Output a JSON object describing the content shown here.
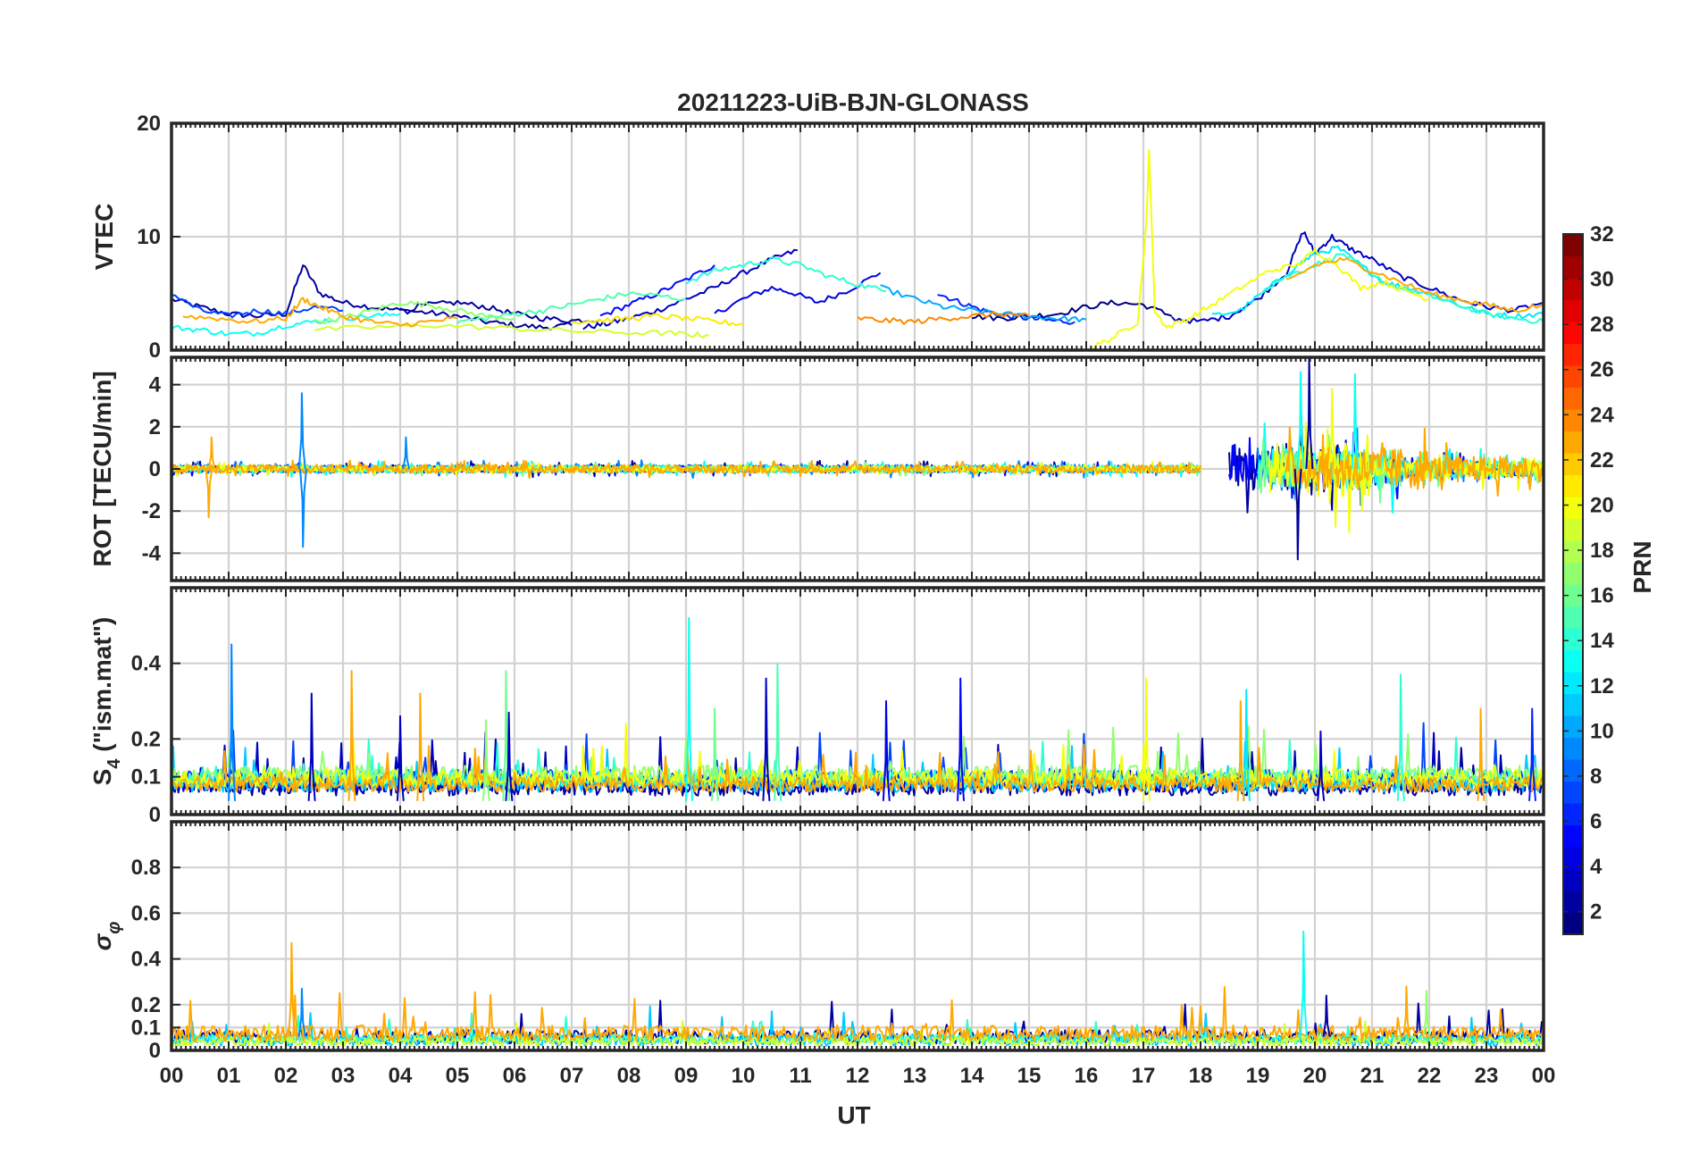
{
  "figure": {
    "title": "20211223-UiB-BJN-GLONASS",
    "xlabel": "UT",
    "x_tick_labels": [
      "00",
      "01",
      "02",
      "03",
      "04",
      "05",
      "06",
      "07",
      "08",
      "09",
      "10",
      "11",
      "12",
      "13",
      "14",
      "15",
      "16",
      "17",
      "18",
      "19",
      "20",
      "21",
      "22",
      "23",
      "00"
    ],
    "colorbar": {
      "label": "PRN",
      "range": [
        1,
        32
      ],
      "ticks": [
        2,
        4,
        6,
        8,
        10,
        12,
        14,
        16,
        18,
        20,
        22,
        24,
        26,
        28,
        30,
        32
      ],
      "colormap": "jet"
    }
  },
  "chart_data": [
    {
      "type": "line",
      "ylabel": "VTEC",
      "ylim": [
        0,
        20
      ],
      "yticks": [
        0,
        10,
        20
      ],
      "x_range_hours": [
        0,
        24
      ],
      "grid": true,
      "series": [
        {
          "prn": 2,
          "t": [
            0,
            0.5,
            1,
            1.5,
            2.0,
            2.3,
            2.6,
            3.0,
            3.5,
            4.0,
            4.5,
            5.0,
            5.5,
            6.0,
            6.5,
            7.0
          ],
          "v": [
            4.5,
            3.8,
            3.2,
            3.0,
            3.2,
            7.5,
            5.0,
            4.2,
            3.8,
            3.5,
            3.3,
            3.0,
            2.5,
            2.2,
            2.0,
            2.2
          ]
        },
        {
          "prn": 4,
          "t": [
            9.5,
            10.0,
            10.5,
            10.9,
            11.3,
            11.8,
            12.4
          ],
          "v": [
            3.2,
            4.5,
            5.5,
            5.0,
            4.2,
            5.2,
            6.8
          ]
        },
        {
          "prn": 3,
          "t": [
            7.2,
            7.6,
            8.0,
            8.5,
            9.0,
            9.5,
            10.0,
            10.5,
            10.95
          ],
          "v": [
            2.0,
            2.3,
            2.8,
            3.5,
            4.5,
            5.5,
            6.8,
            8.0,
            8.8
          ]
        },
        {
          "prn": 5,
          "t": [
            7.5,
            8.0,
            8.5,
            9.0,
            9.5
          ],
          "v": [
            3.0,
            4.0,
            5.0,
            6.2,
            7.5
          ]
        },
        {
          "prn": 6,
          "t": [
            13.4,
            13.8,
            14.2,
            14.6,
            15.0,
            15.4,
            15.8
          ],
          "v": [
            5.0,
            4.2,
            3.5,
            3.0,
            2.8,
            2.6,
            2.5
          ]
        },
        {
          "prn": 2,
          "t": [
            4.0,
            4.5,
            5.0,
            5.5,
            6.0,
            6.5,
            7.0,
            7.5
          ],
          "v": [
            3.5,
            4.0,
            4.2,
            3.8,
            3.2,
            2.8,
            2.6,
            2.7
          ]
        },
        {
          "prn": 1,
          "t": [
            14.0,
            14.5,
            15.0,
            15.5,
            16.0,
            16.5,
            17.0,
            17.5
          ],
          "v": [
            3.0,
            2.8,
            3.0,
            3.2,
            3.8,
            4.2,
            4.0,
            3.0
          ]
        },
        {
          "prn": 7,
          "t": [
            0,
            0.5,
            1.0,
            1.5,
            2.0,
            2.5,
            3.0
          ],
          "v": [
            5.0,
            3.5,
            3.0,
            3.5,
            3.2,
            3.8,
            3.5
          ]
        },
        {
          "prn": 3,
          "t": [
            17.5,
            18.0,
            18.5,
            19.0,
            19.5,
            19.8,
            20.0,
            20.3,
            20.6,
            21.0,
            21.5,
            22.0,
            22.5,
            23.0,
            23.5,
            24.0
          ],
          "v": [
            2.8,
            2.5,
            3.0,
            4.5,
            6.8,
            10.5,
            8.5,
            10.0,
            9.0,
            8.0,
            6.5,
            5.5,
            4.5,
            3.8,
            3.5,
            4.2
          ]
        },
        {
          "prn": 10,
          "t": [
            12.4,
            13.0,
            13.5,
            14.0,
            14.5,
            15.0,
            15.5,
            16.0
          ],
          "v": [
            5.5,
            4.5,
            3.8,
            3.5,
            3.2,
            3.0,
            2.8,
            2.7
          ]
        },
        {
          "prn": 12,
          "t": [
            18.2,
            18.7,
            19.2,
            19.7,
            20.0,
            20.4,
            20.8,
            21.2,
            21.6,
            22.0,
            22.5,
            23.0,
            23.5,
            24.0
          ],
          "v": [
            3.0,
            3.5,
            5.5,
            7.5,
            8.5,
            9.0,
            7.5,
            6.0,
            5.5,
            5.0,
            4.0,
            3.2,
            3.0,
            3.2
          ]
        },
        {
          "prn": 13,
          "t": [
            0,
            0.5,
            1.0,
            1.5,
            2.0,
            2.5,
            3.0,
            3.5,
            4.0
          ],
          "v": [
            2.0,
            1.8,
            1.4,
            1.5,
            2.2,
            2.5,
            2.8,
            3.0,
            3.2
          ]
        },
        {
          "prn": 14,
          "t": [
            9.0,
            9.5,
            10.0,
            10.5,
            11.0,
            11.5,
            12.0,
            12.5
          ],
          "v": [
            6.0,
            7.0,
            7.5,
            8.0,
            7.5,
            6.5,
            5.8,
            5.2
          ]
        },
        {
          "prn": 14,
          "t": [
            19.0,
            19.5,
            20.0,
            20.5,
            21.0,
            21.5,
            22.0,
            22.5,
            23.0,
            23.5,
            24.0
          ],
          "v": [
            5.0,
            6.5,
            7.5,
            8.5,
            6.5,
            5.5,
            4.8,
            4.0,
            3.2,
            2.8,
            2.5
          ]
        },
        {
          "prn": 15,
          "t": [
            5.0,
            5.5,
            6.0,
            6.5,
            7.0,
            7.5,
            8.0,
            8.5,
            9.0
          ],
          "v": [
            2.5,
            2.8,
            3.2,
            3.5,
            4.0,
            4.5,
            5.0,
            4.8,
            4.5
          ]
        },
        {
          "prn": 17,
          "t": [
            2.5,
            3.0,
            3.5,
            4.0,
            4.5,
            5.0,
            5.5,
            6.0
          ],
          "v": [
            2.5,
            2.8,
            3.5,
            4.2,
            4.0,
            3.5,
            3.0,
            2.8
          ]
        },
        {
          "prn": 19,
          "t": [
            2.5,
            3.5,
            4.5,
            5.5,
            6.5,
            7.5,
            8.5,
            9.0,
            9.4
          ],
          "v": [
            1.8,
            2.0,
            2.2,
            2.0,
            1.8,
            1.6,
            1.5,
            1.4,
            1.3
          ]
        },
        {
          "prn": 20,
          "t": [
            16.1,
            16.5,
            16.9,
            17.05,
            17.1,
            17.2,
            17.4,
            17.8,
            18.2,
            18.7,
            19.2,
            19.7,
            20.0,
            20.4,
            20.8,
            21.2,
            21.6,
            22.0
          ],
          "v": [
            0.2,
            1.2,
            2.5,
            11.0,
            17.5,
            3.5,
            2.0,
            2.8,
            4.0,
            5.5,
            7.0,
            7.5,
            8.8,
            7.5,
            5.5,
            6.0,
            5.2,
            4.5
          ]
        },
        {
          "prn": 21,
          "t": [
            7.0,
            7.5,
            8.0,
            8.5,
            9.0,
            9.5,
            10.0
          ],
          "v": [
            2.5,
            2.6,
            2.8,
            3.0,
            2.8,
            2.5,
            2.3
          ]
        },
        {
          "prn": 23,
          "t": [
            0.2,
            0.8,
            1.4,
            2.0,
            2.3,
            2.6,
            3.0,
            3.5,
            4.0,
            4.5,
            5.0
          ],
          "v": [
            3.0,
            2.8,
            2.5,
            2.8,
            4.5,
            3.8,
            3.0,
            2.5,
            2.2,
            2.5,
            2.8
          ]
        },
        {
          "prn": 24,
          "t": [
            12.0,
            12.5,
            13.0,
            13.5,
            14.0,
            14.5,
            15.0
          ],
          "v": [
            2.8,
            2.6,
            2.5,
            2.8,
            3.0,
            3.2,
            3.0
          ]
        },
        {
          "prn": 23,
          "t": [
            19.5,
            20.0,
            20.5,
            21.0,
            21.5,
            22.0,
            22.5,
            23.0,
            23.5,
            24.0
          ],
          "v": [
            6.0,
            7.5,
            8.0,
            7.0,
            6.0,
            5.0,
            4.5,
            4.0,
            3.5,
            4.0
          ]
        }
      ]
    },
    {
      "type": "line",
      "ylabel": "ROT [TECU/min]",
      "ylim": [
        -5.3,
        5.3
      ],
      "yticks": [
        -4,
        -2,
        0,
        2,
        4
      ],
      "x_range_hours": [
        0,
        24
      ],
      "grid": true,
      "noise_traces": [
        {
          "prn": 2,
          "segments": [
            [
              0,
              18
            ],
            [
              18.5,
              20.5
            ],
            [
              20.5,
              24
            ]
          ],
          "amplitude": [
            0.18,
            1.2,
            0.4
          ]
        },
        {
          "prn": 5,
          "segments": [
            [
              0,
              18
            ],
            [
              18.5,
              21.5
            ],
            [
              21.5,
              24
            ]
          ],
          "amplitude": [
            0.15,
            0.8,
            0.3
          ]
        },
        {
          "prn": 9,
          "segments": [
            [
              0,
              18
            ],
            [
              19.0,
              21.0
            ],
            [
              21,
              24
            ]
          ],
          "amplitude": [
            0.2,
            1.0,
            0.35
          ]
        },
        {
          "prn": 13,
          "segments": [
            [
              0,
              18
            ],
            [
              19.0,
              21.5
            ],
            [
              21.5,
              24
            ]
          ],
          "amplitude": [
            0.18,
            1.0,
            0.45
          ]
        },
        {
          "prn": 16,
          "segments": [
            [
              0,
              18
            ],
            [
              19.0,
              21.5
            ],
            [
              21.5,
              24
            ]
          ],
          "amplitude": [
            0.15,
            0.9,
            0.4
          ]
        },
        {
          "prn": 20,
          "segments": [
            [
              0,
              18
            ],
            [
              19.2,
              21.0
            ],
            [
              21,
              24
            ]
          ],
          "amplitude": [
            0.15,
            1.3,
            0.5
          ]
        },
        {
          "prn": 23,
          "segments": [
            [
              0,
              18
            ],
            [
              19.5,
              22.0
            ],
            [
              22,
              24
            ]
          ],
          "amplitude": [
            0.2,
            1.0,
            0.6
          ]
        }
      ],
      "spikes": [
        {
          "prn": 9,
          "t": 2.28,
          "v": 3.6
        },
        {
          "prn": 9,
          "t": 2.3,
          "v": -3.7
        },
        {
          "prn": 23,
          "t": 0.65,
          "v": -2.3
        },
        {
          "prn": 23,
          "t": 0.7,
          "v": 1.5
        },
        {
          "prn": 9,
          "t": 4.1,
          "v": 1.5
        },
        {
          "prn": 13,
          "t": 19.75,
          "v": 4.6
        },
        {
          "prn": 2,
          "t": 19.9,
          "v": 5.3
        },
        {
          "prn": 2,
          "t": 19.7,
          "v": -4.3
        },
        {
          "prn": 20,
          "t": 20.3,
          "v": 3.8
        },
        {
          "prn": 13,
          "t": 20.7,
          "v": 4.5
        },
        {
          "prn": 20,
          "t": 20.6,
          "v": -3.0
        }
      ]
    },
    {
      "type": "line",
      "ylabel": "S4 (\"ism.mat\")",
      "ylabel_main": "S",
      "ylabel_sub": "4",
      "ylabel_rest": " (\"ism.mat\")",
      "ylim": [
        0,
        0.6
      ],
      "yticks": [
        0,
        0.1,
        0.2,
        0.4
      ],
      "x_range_hours": [
        0,
        24
      ],
      "grid": true,
      "baseline_traces": [
        {
          "prn": 2,
          "base": 0.05,
          "amplitude": 0.05
        },
        {
          "prn": 3,
          "base": 0.06,
          "amplitude": 0.05
        },
        {
          "prn": 7,
          "base": 0.07,
          "amplitude": 0.05
        },
        {
          "prn": 11,
          "base": 0.06,
          "amplitude": 0.04
        },
        {
          "prn": 14,
          "base": 0.07,
          "amplitude": 0.05
        },
        {
          "prn": 17,
          "base": 0.08,
          "amplitude": 0.05
        },
        {
          "prn": 20,
          "base": 0.07,
          "amplitude": 0.05
        },
        {
          "prn": 23,
          "base": 0.06,
          "amplitude": 0.04
        }
      ],
      "spikes": [
        {
          "prn": 9,
          "t": 1.05,
          "v": 0.45
        },
        {
          "prn": 3,
          "t": 2.45,
          "v": 0.32
        },
        {
          "prn": 23,
          "t": 3.15,
          "v": 0.38
        },
        {
          "prn": 3,
          "t": 4.0,
          "v": 0.26
        },
        {
          "prn": 23,
          "t": 4.35,
          "v": 0.32
        },
        {
          "prn": 17,
          "t": 5.5,
          "v": 0.25
        },
        {
          "prn": 16,
          "t": 5.85,
          "v": 0.38
        },
        {
          "prn": 3,
          "t": 5.9,
          "v": 0.27
        },
        {
          "prn": 13,
          "t": 9.05,
          "v": 0.52
        },
        {
          "prn": 16,
          "t": 9.5,
          "v": 0.28
        },
        {
          "prn": 15,
          "t": 10.6,
          "v": 0.4
        },
        {
          "prn": 3,
          "t": 10.4,
          "v": 0.36
        },
        {
          "prn": 4,
          "t": 12.5,
          "v": 0.3
        },
        {
          "prn": 5,
          "t": 13.8,
          "v": 0.36
        },
        {
          "prn": 20,
          "t": 17.05,
          "v": 0.36
        },
        {
          "prn": 12,
          "t": 18.8,
          "v": 0.33
        },
        {
          "prn": 23,
          "t": 18.7,
          "v": 0.3
        },
        {
          "prn": 14,
          "t": 21.5,
          "v": 0.37
        },
        {
          "prn": 3,
          "t": 20.1,
          "v": 0.22
        },
        {
          "prn": 23,
          "t": 22.9,
          "v": 0.28
        },
        {
          "prn": 6,
          "t": 23.8,
          "v": 0.28
        }
      ]
    },
    {
      "type": "line",
      "ylabel": "σφ",
      "ylabel_main": "σ",
      "ylabel_sub": "φ",
      "ylim": [
        0,
        1
      ],
      "yticks": [
        0,
        0.1,
        0.2,
        0.4,
        0.6,
        0.8
      ],
      "x_range_hours": [
        0,
        24
      ],
      "grid": true,
      "baseline_traces": [
        {
          "prn": 2,
          "base": 0.03,
          "amplitude": 0.06
        },
        {
          "prn": 11,
          "base": 0.02,
          "amplitude": 0.05
        },
        {
          "prn": 14,
          "base": 0.03,
          "amplitude": 0.04
        },
        {
          "prn": 19,
          "base": 0.02,
          "amplitude": 0.04
        },
        {
          "prn": 23,
          "base": 0.04,
          "amplitude": 0.07
        }
      ],
      "spikes": [
        {
          "prn": 23,
          "t": 2.1,
          "v": 0.47
        },
        {
          "prn": 9,
          "t": 2.28,
          "v": 0.27
        },
        {
          "prn": 13,
          "t": 19.8,
          "v": 0.52
        },
        {
          "prn": 2,
          "t": 20.2,
          "v": 0.24
        },
        {
          "prn": 23,
          "t": 21.6,
          "v": 0.28
        },
        {
          "prn": 17,
          "t": 21.95,
          "v": 0.26
        }
      ]
    }
  ]
}
